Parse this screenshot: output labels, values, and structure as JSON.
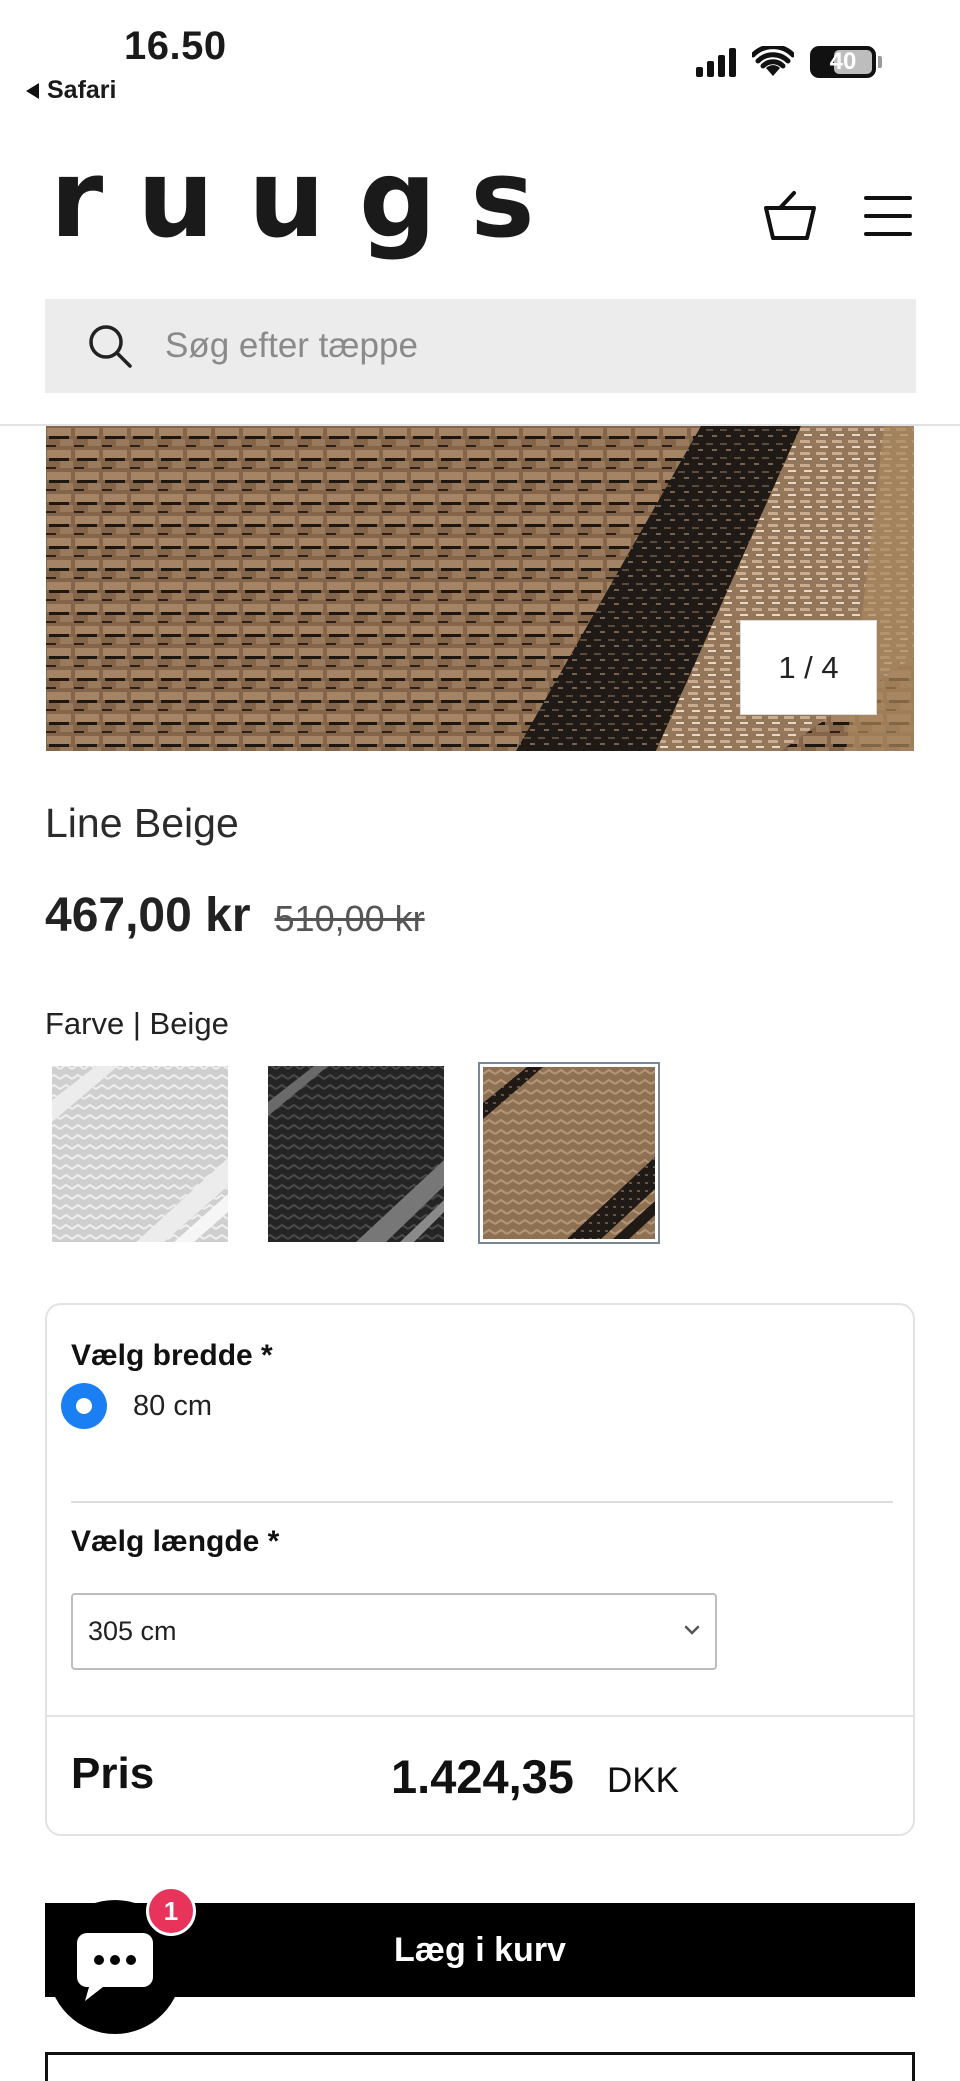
{
  "status_bar": {
    "time": "16.50",
    "back_label": "Safari",
    "battery": "40"
  },
  "header": {
    "logo": "ruugs",
    "search_placeholder": "Søg efter tæppe"
  },
  "gallery": {
    "pager": "1 / 4"
  },
  "product": {
    "title": "Line Beige",
    "price": "467,00 kr",
    "old_price": "510,00 kr",
    "color_label": "Farve | Beige",
    "swatches": [
      "Grey",
      "Black",
      "Beige"
    ],
    "selected_swatch": "Beige"
  },
  "options": {
    "width_heading": "Vælg bredde *",
    "width_option": "80 cm",
    "length_heading": "Vælg længde *",
    "length_value": "305 cm",
    "total_label": "Pris",
    "total_value": "1.424,35",
    "currency": "DKK"
  },
  "actions": {
    "add_to_cart": "Læg i kurv",
    "chat_badge": "1"
  },
  "colors": {
    "accent_radio": "#1a7ff3",
    "badge": "#e8345b",
    "button": "#000000"
  }
}
